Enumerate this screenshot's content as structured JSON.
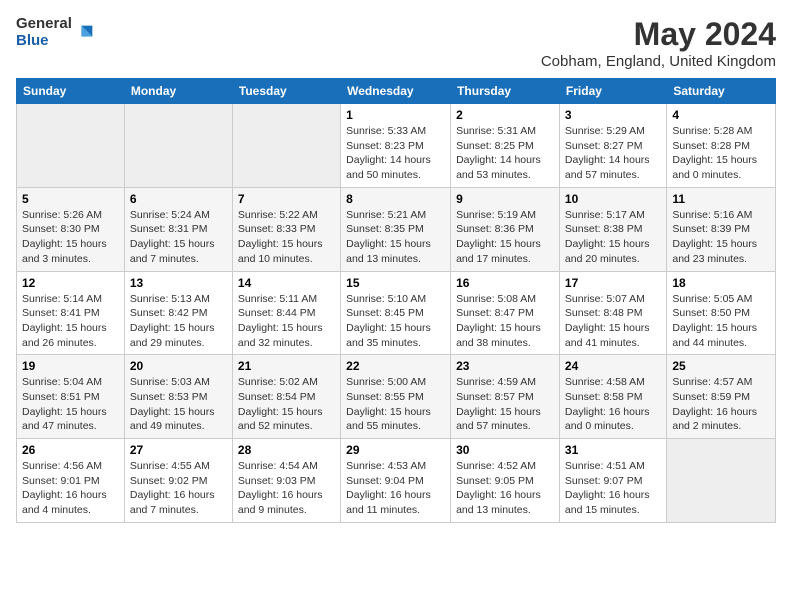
{
  "logo": {
    "general": "General",
    "blue": "Blue"
  },
  "title": {
    "month_year": "May 2024",
    "location": "Cobham, England, United Kingdom"
  },
  "headers": [
    "Sunday",
    "Monday",
    "Tuesday",
    "Wednesday",
    "Thursday",
    "Friday",
    "Saturday"
  ],
  "weeks": [
    [
      {
        "day": "",
        "info": ""
      },
      {
        "day": "",
        "info": ""
      },
      {
        "day": "",
        "info": ""
      },
      {
        "day": "1",
        "info": "Sunrise: 5:33 AM\nSunset: 8:23 PM\nDaylight: 14 hours\nand 50 minutes."
      },
      {
        "day": "2",
        "info": "Sunrise: 5:31 AM\nSunset: 8:25 PM\nDaylight: 14 hours\nand 53 minutes."
      },
      {
        "day": "3",
        "info": "Sunrise: 5:29 AM\nSunset: 8:27 PM\nDaylight: 14 hours\nand 57 minutes."
      },
      {
        "day": "4",
        "info": "Sunrise: 5:28 AM\nSunset: 8:28 PM\nDaylight: 15 hours\nand 0 minutes."
      }
    ],
    [
      {
        "day": "5",
        "info": "Sunrise: 5:26 AM\nSunset: 8:30 PM\nDaylight: 15 hours\nand 3 minutes."
      },
      {
        "day": "6",
        "info": "Sunrise: 5:24 AM\nSunset: 8:31 PM\nDaylight: 15 hours\nand 7 minutes."
      },
      {
        "day": "7",
        "info": "Sunrise: 5:22 AM\nSunset: 8:33 PM\nDaylight: 15 hours\nand 10 minutes."
      },
      {
        "day": "8",
        "info": "Sunrise: 5:21 AM\nSunset: 8:35 PM\nDaylight: 15 hours\nand 13 minutes."
      },
      {
        "day": "9",
        "info": "Sunrise: 5:19 AM\nSunset: 8:36 PM\nDaylight: 15 hours\nand 17 minutes."
      },
      {
        "day": "10",
        "info": "Sunrise: 5:17 AM\nSunset: 8:38 PM\nDaylight: 15 hours\nand 20 minutes."
      },
      {
        "day": "11",
        "info": "Sunrise: 5:16 AM\nSunset: 8:39 PM\nDaylight: 15 hours\nand 23 minutes."
      }
    ],
    [
      {
        "day": "12",
        "info": "Sunrise: 5:14 AM\nSunset: 8:41 PM\nDaylight: 15 hours\nand 26 minutes."
      },
      {
        "day": "13",
        "info": "Sunrise: 5:13 AM\nSunset: 8:42 PM\nDaylight: 15 hours\nand 29 minutes."
      },
      {
        "day": "14",
        "info": "Sunrise: 5:11 AM\nSunset: 8:44 PM\nDaylight: 15 hours\nand 32 minutes."
      },
      {
        "day": "15",
        "info": "Sunrise: 5:10 AM\nSunset: 8:45 PM\nDaylight: 15 hours\nand 35 minutes."
      },
      {
        "day": "16",
        "info": "Sunrise: 5:08 AM\nSunset: 8:47 PM\nDaylight: 15 hours\nand 38 minutes."
      },
      {
        "day": "17",
        "info": "Sunrise: 5:07 AM\nSunset: 8:48 PM\nDaylight: 15 hours\nand 41 minutes."
      },
      {
        "day": "18",
        "info": "Sunrise: 5:05 AM\nSunset: 8:50 PM\nDaylight: 15 hours\nand 44 minutes."
      }
    ],
    [
      {
        "day": "19",
        "info": "Sunrise: 5:04 AM\nSunset: 8:51 PM\nDaylight: 15 hours\nand 47 minutes."
      },
      {
        "day": "20",
        "info": "Sunrise: 5:03 AM\nSunset: 8:53 PM\nDaylight: 15 hours\nand 49 minutes."
      },
      {
        "day": "21",
        "info": "Sunrise: 5:02 AM\nSunset: 8:54 PM\nDaylight: 15 hours\nand 52 minutes."
      },
      {
        "day": "22",
        "info": "Sunrise: 5:00 AM\nSunset: 8:55 PM\nDaylight: 15 hours\nand 55 minutes."
      },
      {
        "day": "23",
        "info": "Sunrise: 4:59 AM\nSunset: 8:57 PM\nDaylight: 15 hours\nand 57 minutes."
      },
      {
        "day": "24",
        "info": "Sunrise: 4:58 AM\nSunset: 8:58 PM\nDaylight: 16 hours\nand 0 minutes."
      },
      {
        "day": "25",
        "info": "Sunrise: 4:57 AM\nSunset: 8:59 PM\nDaylight: 16 hours\nand 2 minutes."
      }
    ],
    [
      {
        "day": "26",
        "info": "Sunrise: 4:56 AM\nSunset: 9:01 PM\nDaylight: 16 hours\nand 4 minutes."
      },
      {
        "day": "27",
        "info": "Sunrise: 4:55 AM\nSunset: 9:02 PM\nDaylight: 16 hours\nand 7 minutes."
      },
      {
        "day": "28",
        "info": "Sunrise: 4:54 AM\nSunset: 9:03 PM\nDaylight: 16 hours\nand 9 minutes."
      },
      {
        "day": "29",
        "info": "Sunrise: 4:53 AM\nSunset: 9:04 PM\nDaylight: 16 hours\nand 11 minutes."
      },
      {
        "day": "30",
        "info": "Sunrise: 4:52 AM\nSunset: 9:05 PM\nDaylight: 16 hours\nand 13 minutes."
      },
      {
        "day": "31",
        "info": "Sunrise: 4:51 AM\nSunset: 9:07 PM\nDaylight: 16 hours\nand 15 minutes."
      },
      {
        "day": "",
        "info": ""
      }
    ]
  ]
}
